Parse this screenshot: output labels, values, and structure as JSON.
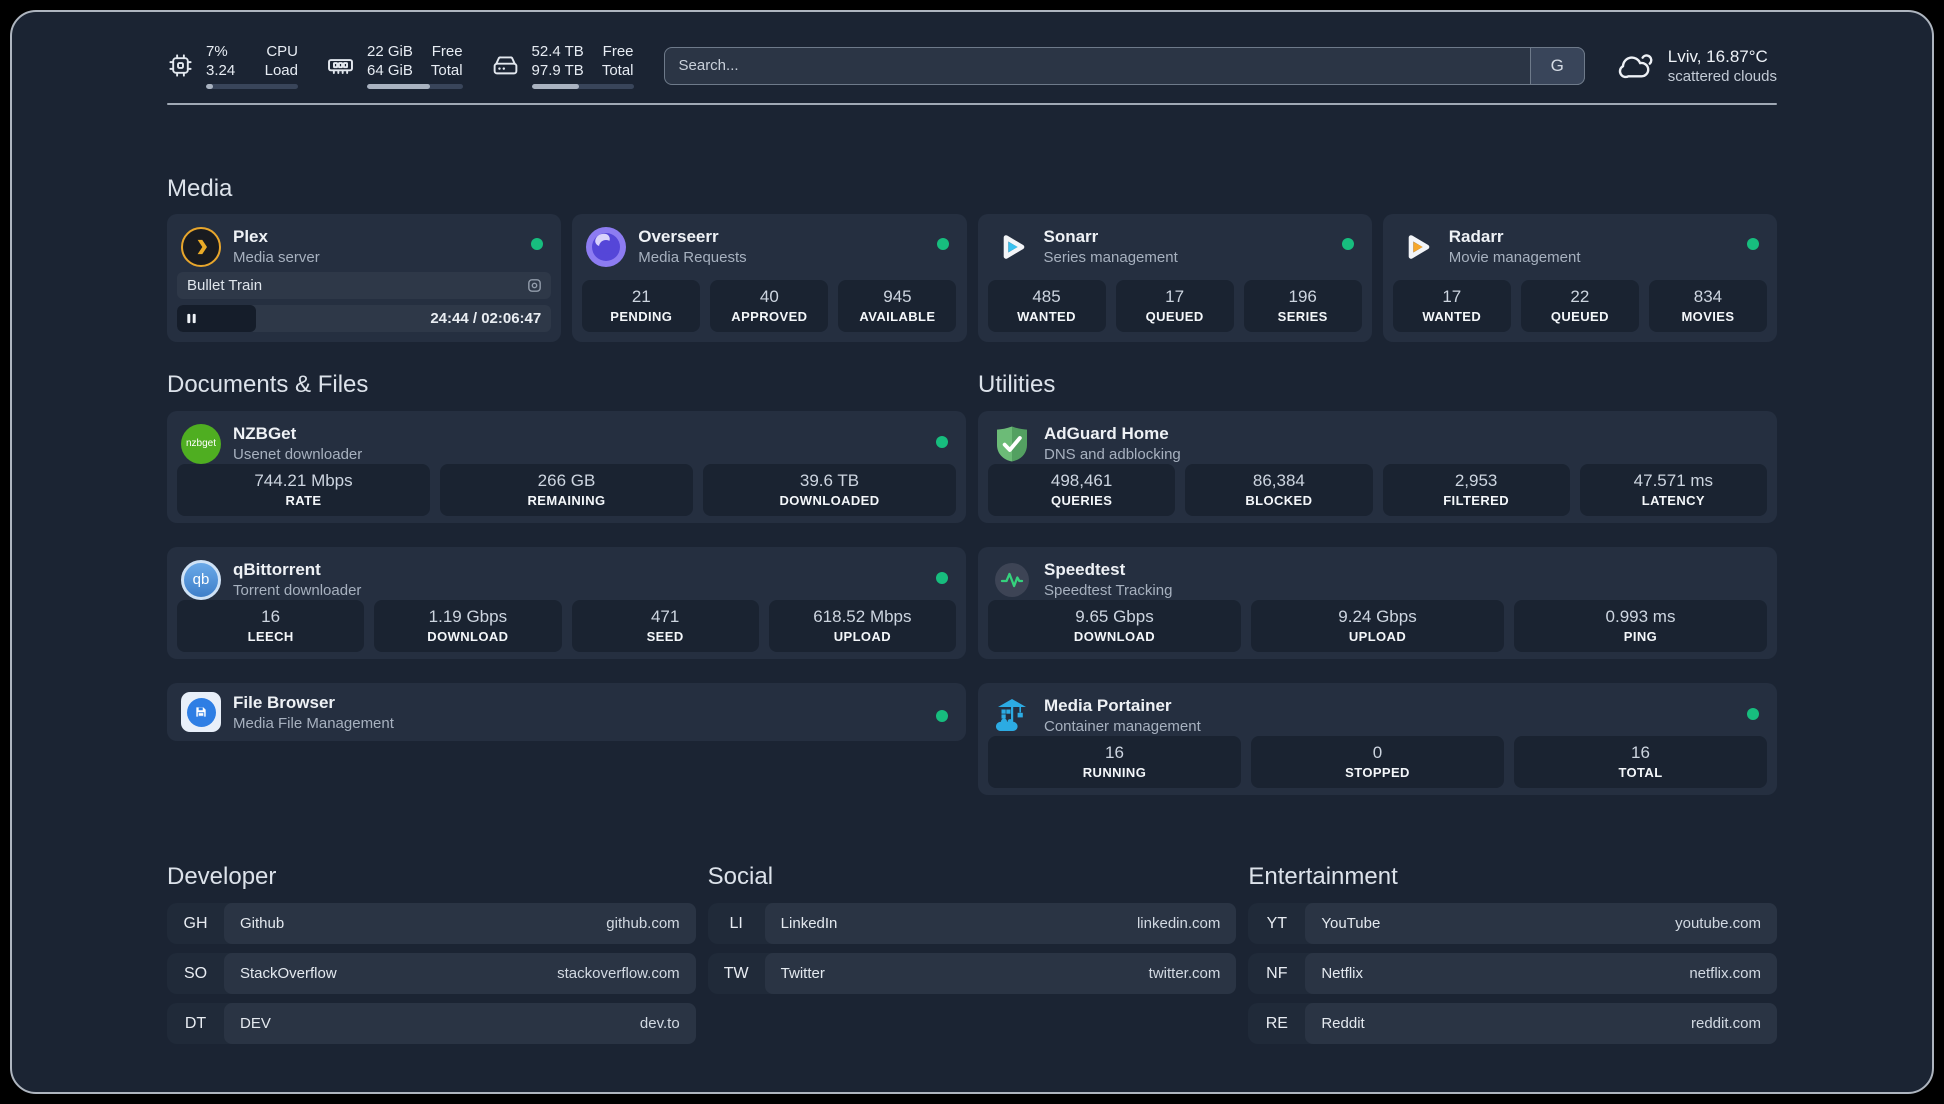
{
  "topbar": {
    "resources": [
      {
        "icon": "cpu-icon",
        "values": [
          "7%",
          "3.24"
        ],
        "labels": [
          "CPU",
          "Load"
        ],
        "progress_pct": 8
      },
      {
        "icon": "memory-icon",
        "values": [
          "22 GiB",
          "64 GiB"
        ],
        "labels": [
          "Free",
          "Total"
        ],
        "progress_pct": 66
      },
      {
        "icon": "disk-icon",
        "values": [
          "52.4 TB",
          "97.9 TB"
        ],
        "labels": [
          "Free",
          "Total"
        ],
        "progress_pct": 47
      }
    ],
    "search": {
      "placeholder": "Search...",
      "engine_button": "G"
    },
    "weather": {
      "icon": "cloud-icon",
      "location": "Lviv, 16.87°C",
      "condition": "scattered clouds"
    }
  },
  "sections": {
    "media": {
      "title": "Media"
    },
    "documents": {
      "title": "Documents & Files"
    },
    "utilities": {
      "title": "Utilities"
    },
    "developer": {
      "title": "Developer"
    },
    "social": {
      "title": "Social"
    },
    "entertainment": {
      "title": "Entertainment"
    }
  },
  "services": {
    "plex": {
      "name": "Plex",
      "desc": "Media server",
      "status": "online",
      "icon": "plex-icon",
      "player": {
        "title": "Bullet Train",
        "time_display": "24:44 / 02:06:47",
        "progress_pct": 21
      }
    },
    "overseerr": {
      "name": "Overseerr",
      "desc": "Media Requests",
      "status": "online",
      "icon": "overseerr-icon",
      "stats": [
        {
          "value": "21",
          "label": "PENDING"
        },
        {
          "value": "40",
          "label": "APPROVED"
        },
        {
          "value": "945",
          "label": "AVAILABLE"
        }
      ]
    },
    "sonarr": {
      "name": "Sonarr",
      "desc": "Series management",
      "status": "online",
      "icon": "sonarr-icon",
      "stats": [
        {
          "value": "485",
          "label": "WANTED"
        },
        {
          "value": "17",
          "label": "QUEUED"
        },
        {
          "value": "196",
          "label": "SERIES"
        }
      ]
    },
    "radarr": {
      "name": "Radarr",
      "desc": "Movie management",
      "status": "online",
      "icon": "radarr-icon",
      "stats": [
        {
          "value": "17",
          "label": "WANTED"
        },
        {
          "value": "22",
          "label": "QUEUED"
        },
        {
          "value": "834",
          "label": "MOVIES"
        }
      ]
    },
    "nzbget": {
      "name": "NZBGet",
      "desc": "Usenet downloader",
      "status": "online",
      "icon": "nzbget-icon",
      "stats": [
        {
          "value": "744.21 Mbps",
          "label": "RATE"
        },
        {
          "value": "266 GB",
          "label": "REMAINING"
        },
        {
          "value": "39.6 TB",
          "label": "DOWNLOADED"
        }
      ]
    },
    "qbittorrent": {
      "name": "qBittorrent",
      "desc": "Torrent downloader",
      "status": "online",
      "icon": "qbittorrent-icon",
      "stats": [
        {
          "value": "16",
          "label": "LEECH"
        },
        {
          "value": "1.19 Gbps",
          "label": "DOWNLOAD"
        },
        {
          "value": "471",
          "label": "SEED"
        },
        {
          "value": "618.52 Mbps",
          "label": "UPLOAD"
        }
      ]
    },
    "filebrowser": {
      "name": "File Browser",
      "desc": "Media File Management",
      "status": "online",
      "icon": "filebrowser-icon"
    },
    "adguard": {
      "name": "AdGuard Home",
      "desc": "DNS and adblocking",
      "icon": "adguard-icon",
      "stats": [
        {
          "value": "498,461",
          "label": "QUERIES"
        },
        {
          "value": "86,384",
          "label": "BLOCKED"
        },
        {
          "value": "2,953",
          "label": "FILTERED"
        },
        {
          "value": "47.571 ms",
          "label": "LATENCY"
        }
      ]
    },
    "speedtest": {
      "name": "Speedtest",
      "desc": "Speedtest Tracking",
      "icon": "speedtest-icon",
      "stats": [
        {
          "value": "9.65 Gbps",
          "label": "DOWNLOAD"
        },
        {
          "value": "9.24 Gbps",
          "label": "UPLOAD"
        },
        {
          "value": "0.993 ms",
          "label": "PING"
        }
      ]
    },
    "portainer": {
      "name": "Media Portainer",
      "desc": "Container management",
      "status": "online",
      "icon": "portainer-icon",
      "stats": [
        {
          "value": "16",
          "label": "RUNNING"
        },
        {
          "value": "0",
          "label": "STOPPED"
        },
        {
          "value": "16",
          "label": "TOTAL"
        }
      ]
    }
  },
  "bookmarks": {
    "developer": [
      {
        "abbr": "GH",
        "name": "Github",
        "url": "github.com"
      },
      {
        "abbr": "SO",
        "name": "StackOverflow",
        "url": "stackoverflow.com"
      },
      {
        "abbr": "DT",
        "name": "DEV",
        "url": "dev.to"
      }
    ],
    "social": [
      {
        "abbr": "LI",
        "name": "LinkedIn",
        "url": "linkedin.com"
      },
      {
        "abbr": "TW",
        "name": "Twitter",
        "url": "twitter.com"
      }
    ],
    "entertainment": [
      {
        "abbr": "YT",
        "name": "YouTube",
        "url": "youtube.com"
      },
      {
        "abbr": "NF",
        "name": "Netflix",
        "url": "netflix.com"
      },
      {
        "abbr": "RE",
        "name": "Reddit",
        "url": "reddit.com"
      }
    ]
  },
  "colors": {
    "status_online": "#17bd7e",
    "background": "#1b2433",
    "card": "#252f40"
  }
}
